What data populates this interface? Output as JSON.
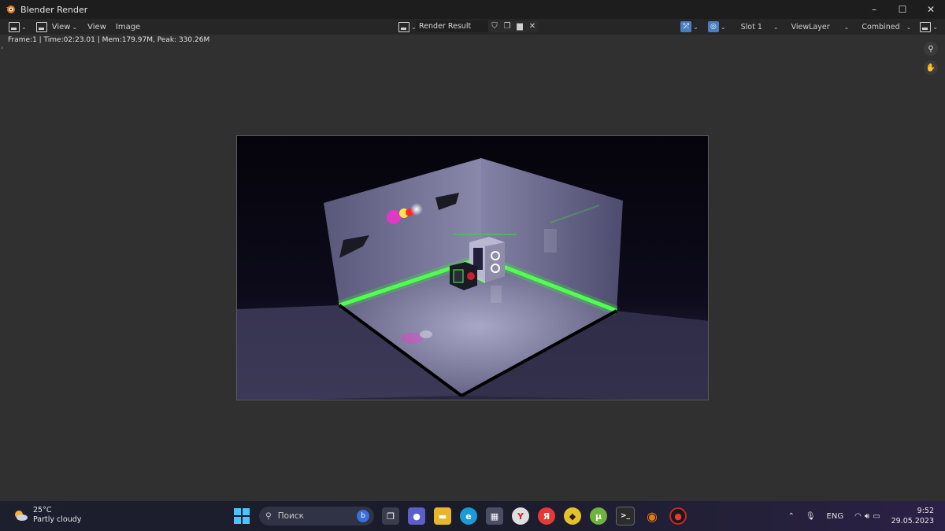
{
  "window": {
    "title": "Blender Render",
    "controls": {
      "minimize": "–",
      "maximize": "☐",
      "close": "✕"
    }
  },
  "header": {
    "view_dropdown": "View",
    "menus": [
      "View",
      "Image"
    ],
    "image_name": "Render Result",
    "slot": "Slot 1",
    "view_layer": "ViewLayer",
    "pass": "Combined"
  },
  "info": {
    "stats": "Frame:1 | Time:02:23.01 | Mem:179.97M, Peak: 330.26M"
  },
  "taskbar": {
    "weather_temp": "25°C",
    "weather_desc": "Partly cloudy",
    "search_placeholder": "Поиск",
    "language": "ENG",
    "time": "9:52",
    "date": "29.05.2023",
    "apps": [
      {
        "name": "bing",
        "glyph": "b",
        "color": "#3a6fd8"
      },
      {
        "name": "task-view",
        "glyph": "❐",
        "color": "#3a3d4e"
      },
      {
        "name": "chat",
        "glyph": "●",
        "color": "#5b5fc7"
      },
      {
        "name": "file-explorer",
        "glyph": "▬",
        "color": "#e8b531"
      },
      {
        "name": "edge",
        "glyph": "e",
        "color": "#1b9ad6"
      },
      {
        "name": "store",
        "glyph": "▦",
        "color": "#4a4f66"
      },
      {
        "name": "yandex-browser",
        "glyph": "Y",
        "color": "#e0e0e0"
      },
      {
        "name": "yandex",
        "glyph": "Я",
        "color": "#e53935"
      },
      {
        "name": "app-yellow",
        "glyph": "◆",
        "color": "#e6c22a"
      },
      {
        "name": "utorrent",
        "glyph": "µ",
        "color": "#6fb33e"
      },
      {
        "name": "terminal",
        "glyph": ">_",
        "color": "#2c2c2c"
      },
      {
        "name": "blender",
        "glyph": "◉",
        "color": "#e87d0d"
      },
      {
        "name": "recorder",
        "glyph": "●",
        "color": "#c62828"
      }
    ]
  }
}
